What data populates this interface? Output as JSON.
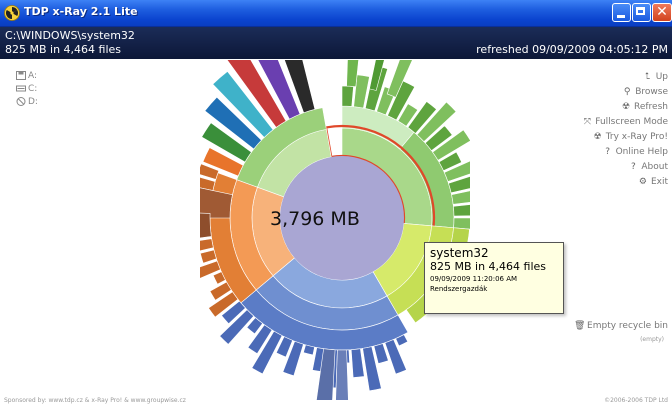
{
  "window": {
    "title": "TDP x-Ray 2.1 Lite",
    "minimize_icon": "minimize-icon",
    "maximize_icon": "maximize-icon",
    "close_icon": "close-icon"
  },
  "header": {
    "path": "C:\\WINDOWS\\system32",
    "summary": "825 MB in 4,464 files",
    "refreshed": "refreshed 09/09/2009 04:05:12 PM",
    "background": "#142350"
  },
  "drives": [
    {
      "label": "A:",
      "icon": "floppy-icon"
    },
    {
      "label": "C:",
      "icon": "hard-drive-icon"
    },
    {
      "label": "D:",
      "icon": "cd-drive-icon"
    }
  ],
  "menu": [
    {
      "label": "Up",
      "icon": "up-arrow-icon"
    },
    {
      "label": "Browse",
      "icon": "magnifier-icon"
    },
    {
      "label": "Refresh",
      "icon": "radiation-icon"
    },
    {
      "label": "Fullscreen Mode",
      "icon": "fullscreen-icon"
    },
    {
      "label": "Try x-Ray Pro!",
      "icon": "radiation-icon"
    },
    {
      "label": "Online Help",
      "icon": "question-icon"
    },
    {
      "label": "About",
      "icon": "question-icon"
    },
    {
      "label": "Exit",
      "icon": "exit-icon"
    }
  ],
  "recycle": {
    "label": "Empty recycle bin",
    "status": "(empty)",
    "icon": "trash-icon"
  },
  "chart": {
    "center_label": "3,796 MB",
    "highlight_color": "#e0482a",
    "center_color": "#a9a6d3"
  },
  "tooltip": {
    "name": "system32",
    "files": "825 MB in 4,464 files",
    "date": "09/09/2009 11:20:06 AM",
    "owner": "Rendszergazdák"
  },
  "footer": {
    "left": "Sponsored by: www.tdp.cz & x-Ray Pro! & www.groupwise.cz",
    "right": "©2006-2006 TDP Ltd"
  }
}
